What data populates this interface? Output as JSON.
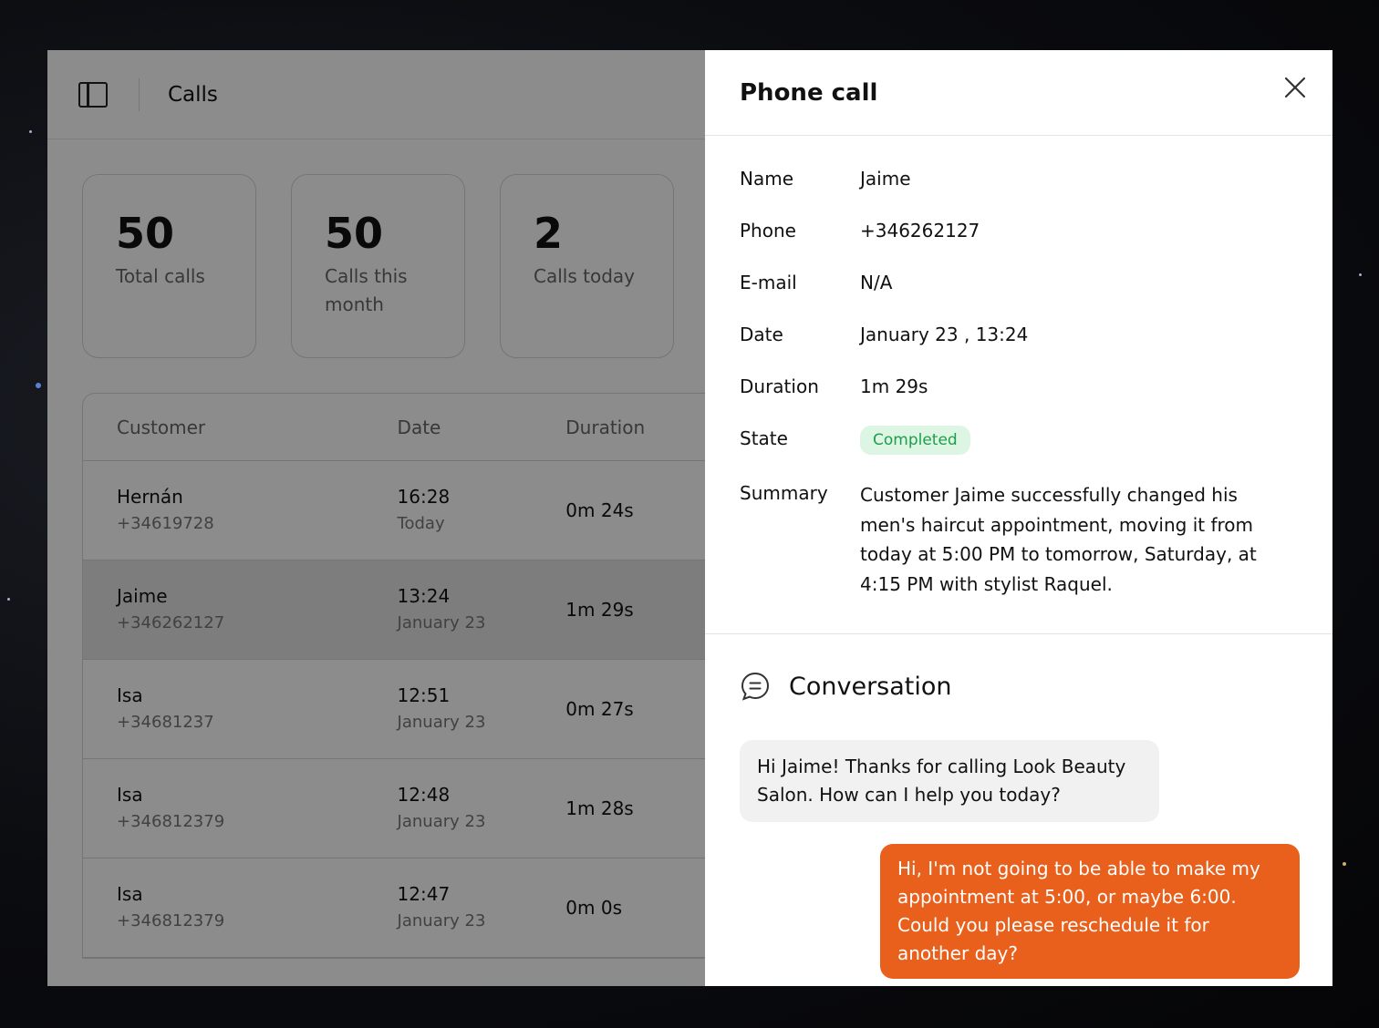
{
  "header": {
    "title": "Calls"
  },
  "stats": [
    {
      "value": "50",
      "label": "Total calls"
    },
    {
      "value": "50",
      "label": "Calls this month"
    },
    {
      "value": "2",
      "label": "Calls today"
    }
  ],
  "table": {
    "columns": [
      "Customer",
      "Date",
      "Duration"
    ],
    "rows": [
      {
        "name": "Hernán",
        "phone": "+34619728",
        "time": "16:28",
        "day": "Today",
        "duration": "0m 24s"
      },
      {
        "name": "Jaime",
        "phone": "+346262127",
        "time": "13:24",
        "day": "January 23",
        "duration": "1m 29s"
      },
      {
        "name": "Isa",
        "phone": "+34681237",
        "time": "12:51",
        "day": "January 23",
        "duration": "0m 27s"
      },
      {
        "name": "Isa",
        "phone": "+346812379",
        "time": "12:48",
        "day": "January 23",
        "duration": "1m 28s"
      },
      {
        "name": "Isa",
        "phone": "+346812379",
        "time": "12:47",
        "day": "January 23",
        "duration": "0m 0s"
      }
    ]
  },
  "drawer": {
    "title": "Phone call",
    "fields": {
      "name_label": "Name",
      "name": "Jaime",
      "phone_label": "Phone",
      "phone": "+346262127",
      "email_label": "E-mail",
      "email": "N/A",
      "date_label": "Date",
      "date": "January 23 , 13:24",
      "duration_label": "Duration",
      "duration": "1m 29s",
      "state_label": "State",
      "state": "Completed",
      "summary_label": "Summary",
      "summary": "Customer Jaime successfully changed his men's haircut appointment, moving it from today at 5:00 PM to tomorrow, Saturday, at 4:15 PM with stylist Raquel."
    },
    "conversation": {
      "title": "Conversation",
      "messages": [
        {
          "from": "agent",
          "text": "Hi Jaime! Thanks for calling Look Beauty Salon. How can I help you today?"
        },
        {
          "from": "customer",
          "text": "Hi, I'm not going to be able to make my appointment at 5:00, or maybe 6:00. Could you please reschedule it for another day?"
        }
      ]
    }
  },
  "colors": {
    "accent": "#e8601c",
    "badge_bg": "#dcf6e3",
    "badge_text": "#1f9d4c"
  }
}
